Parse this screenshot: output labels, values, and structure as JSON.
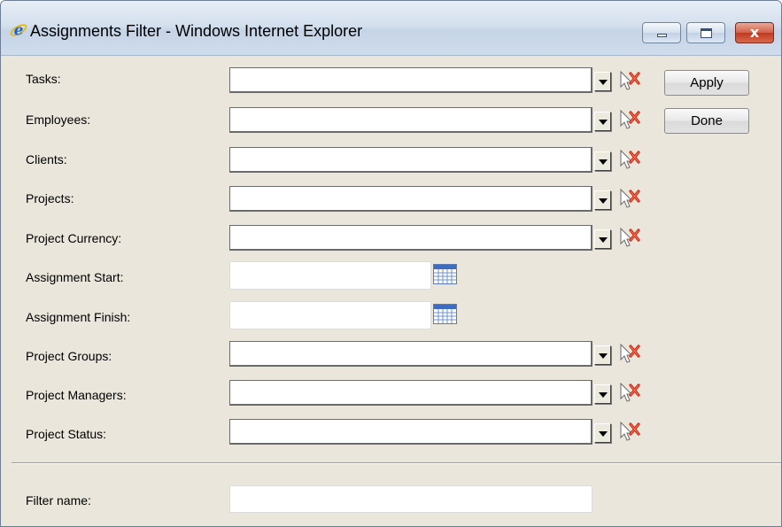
{
  "window": {
    "title": "Assignments Filter - Windows Internet Explorer",
    "accent_color": "#d4e0ee",
    "close_color": "#c0381f"
  },
  "buttons": {
    "apply": "Apply",
    "done": "Done"
  },
  "fields": {
    "tasks": {
      "label": "Tasks:",
      "value": ""
    },
    "employees": {
      "label": "Employees:",
      "value": ""
    },
    "clients": {
      "label": "Clients:",
      "value": ""
    },
    "projects": {
      "label": "Projects:",
      "value": ""
    },
    "project_currency": {
      "label": "Project Currency:",
      "value": ""
    },
    "assignment_start": {
      "label": "Assignment Start:",
      "value": ""
    },
    "assignment_finish": {
      "label": "Assignment Finish:",
      "value": ""
    },
    "project_groups": {
      "label": "Project Groups:",
      "value": ""
    },
    "project_managers": {
      "label": "Project Managers:",
      "value": ""
    },
    "project_status": {
      "label": "Project Status:",
      "value": ""
    },
    "filter_name": {
      "label": "Filter name:",
      "value": ""
    }
  },
  "icons": {
    "title": "internet-explorer-icon",
    "dropdown": "chevron-down-icon",
    "clear": "clear-filter-icon",
    "calendar": "calendar-icon",
    "minimize": "minimize-icon",
    "maximize": "maximize-icon",
    "close": "close-icon"
  }
}
